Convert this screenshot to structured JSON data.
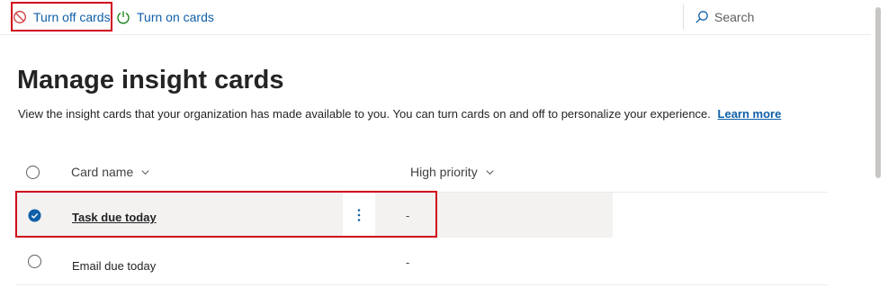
{
  "toolbar": {
    "turn_off_label": "Turn off cards",
    "turn_on_label": "Turn on cards",
    "search_placeholder": "Search"
  },
  "page": {
    "title": "Manage insight cards",
    "description": "View the insight cards that your organization has made available to you. You can turn cards on and off to personalize your experience.",
    "learn_more": "Learn more"
  },
  "table": {
    "columns": [
      {
        "label": "Card name"
      },
      {
        "label": "High priority"
      }
    ],
    "rows": [
      {
        "name": "Task due today",
        "high_priority": "-",
        "selected": true
      },
      {
        "name": "Email due today",
        "high_priority": "-",
        "selected": false
      }
    ]
  },
  "colors": {
    "accent": "#0f5fa8",
    "turn_off_icon": "#d13438",
    "turn_on_icon": "#107c10",
    "highlight": "#d0021b",
    "selected_row": "#f3f2f1"
  },
  "icons": {
    "turn_off": "blocked-icon",
    "turn_on": "power-icon",
    "search": "search-icon",
    "sort": "chevron-down-icon",
    "check": "checkmark-circle-icon",
    "more": "more-vertical-icon"
  }
}
